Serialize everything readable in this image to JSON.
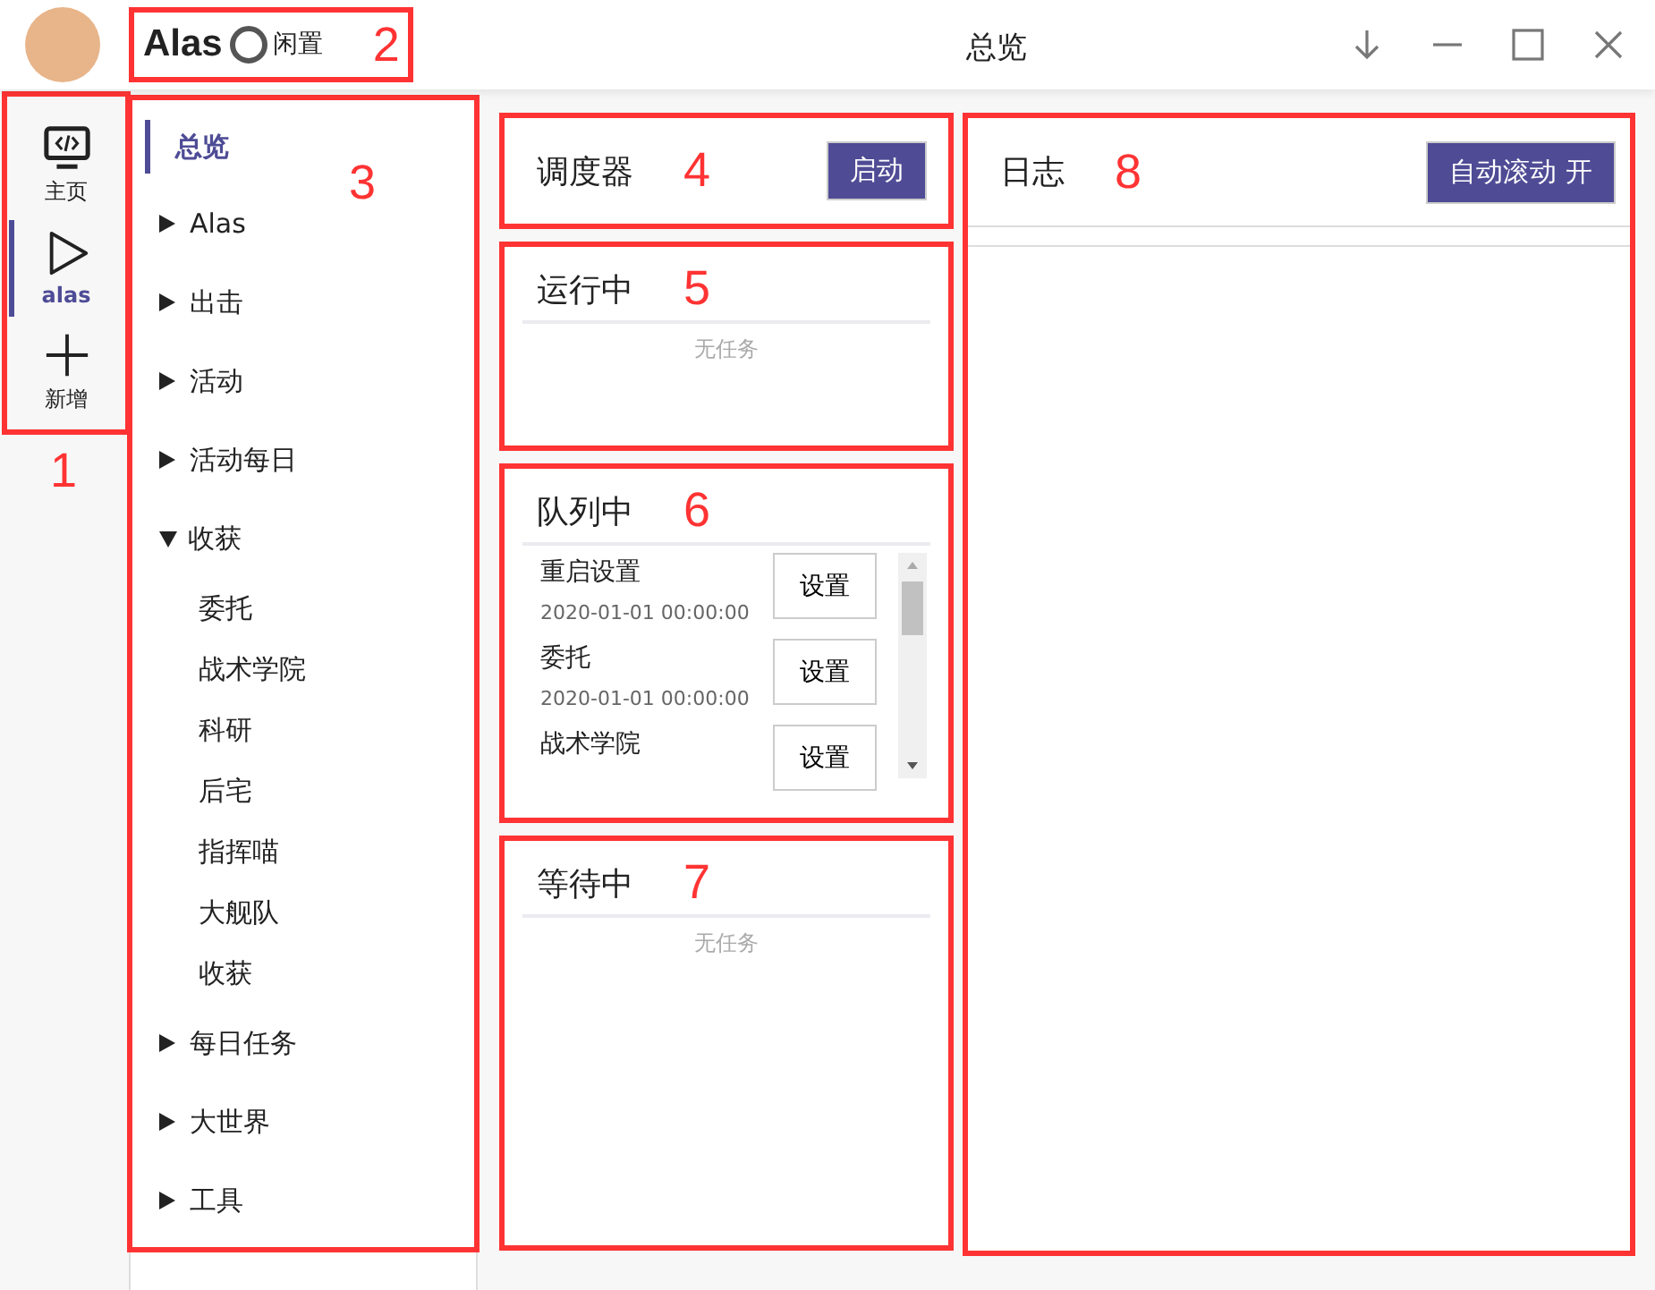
{
  "window": {
    "app_name": "Alas",
    "status": "闲置",
    "title": "总览",
    "callout": "2"
  },
  "rail": {
    "callout": "1",
    "items": [
      {
        "label": "主页",
        "kind": "monitor",
        "selected": false
      },
      {
        "label": "alas",
        "kind": "play",
        "selected": true
      },
      {
        "label": "新增",
        "kind": "plus",
        "selected": false
      }
    ]
  },
  "nav": {
    "callout": "3",
    "items": [
      {
        "label": "总览",
        "kind": "page",
        "selected": true
      },
      {
        "label": "Alas",
        "kind": "group",
        "expanded": false,
        "selected": false
      },
      {
        "label": "出击",
        "kind": "group",
        "expanded": false,
        "selected": false
      },
      {
        "label": "活动",
        "kind": "group",
        "expanded": false,
        "selected": false
      },
      {
        "label": "活动每日",
        "kind": "group",
        "expanded": false,
        "selected": false
      },
      {
        "label": "收获",
        "kind": "group",
        "expanded": true,
        "selected": false,
        "children": [
          {
            "label": "委托",
            "selected": false
          },
          {
            "label": "战术学院",
            "selected": false
          },
          {
            "label": "科研",
            "selected": false
          },
          {
            "label": "后宅",
            "selected": false
          },
          {
            "label": "指挥喵",
            "selected": false
          },
          {
            "label": "大舰队",
            "selected": false
          },
          {
            "label": "收获",
            "selected": false
          }
        ]
      },
      {
        "label": "每日任务",
        "kind": "group",
        "expanded": false,
        "selected": false
      },
      {
        "label": "大世界",
        "kind": "group",
        "expanded": false,
        "selected": false
      },
      {
        "label": "工具",
        "kind": "group",
        "expanded": false,
        "selected": false
      }
    ]
  },
  "scheduler": {
    "title": "调度器",
    "button": "启动",
    "callout": "4"
  },
  "running": {
    "title": "运行中",
    "empty_text": "无任务",
    "callout": "5"
  },
  "queue": {
    "title": "队列中",
    "callout": "6",
    "tasks": [
      {
        "name": "重启设置",
        "time": "2020-01-01 00:00:00",
        "button": "设置"
      },
      {
        "name": "委托",
        "time": "2020-01-01 00:00:00",
        "button": "设置"
      },
      {
        "name": "战术学院",
        "button": "设置"
      }
    ]
  },
  "waiting": {
    "title": "等待中",
    "empty_text": "无任务",
    "callout": "7"
  },
  "log": {
    "title": "日志",
    "button": "自动滚动 开",
    "callout": "8"
  }
}
